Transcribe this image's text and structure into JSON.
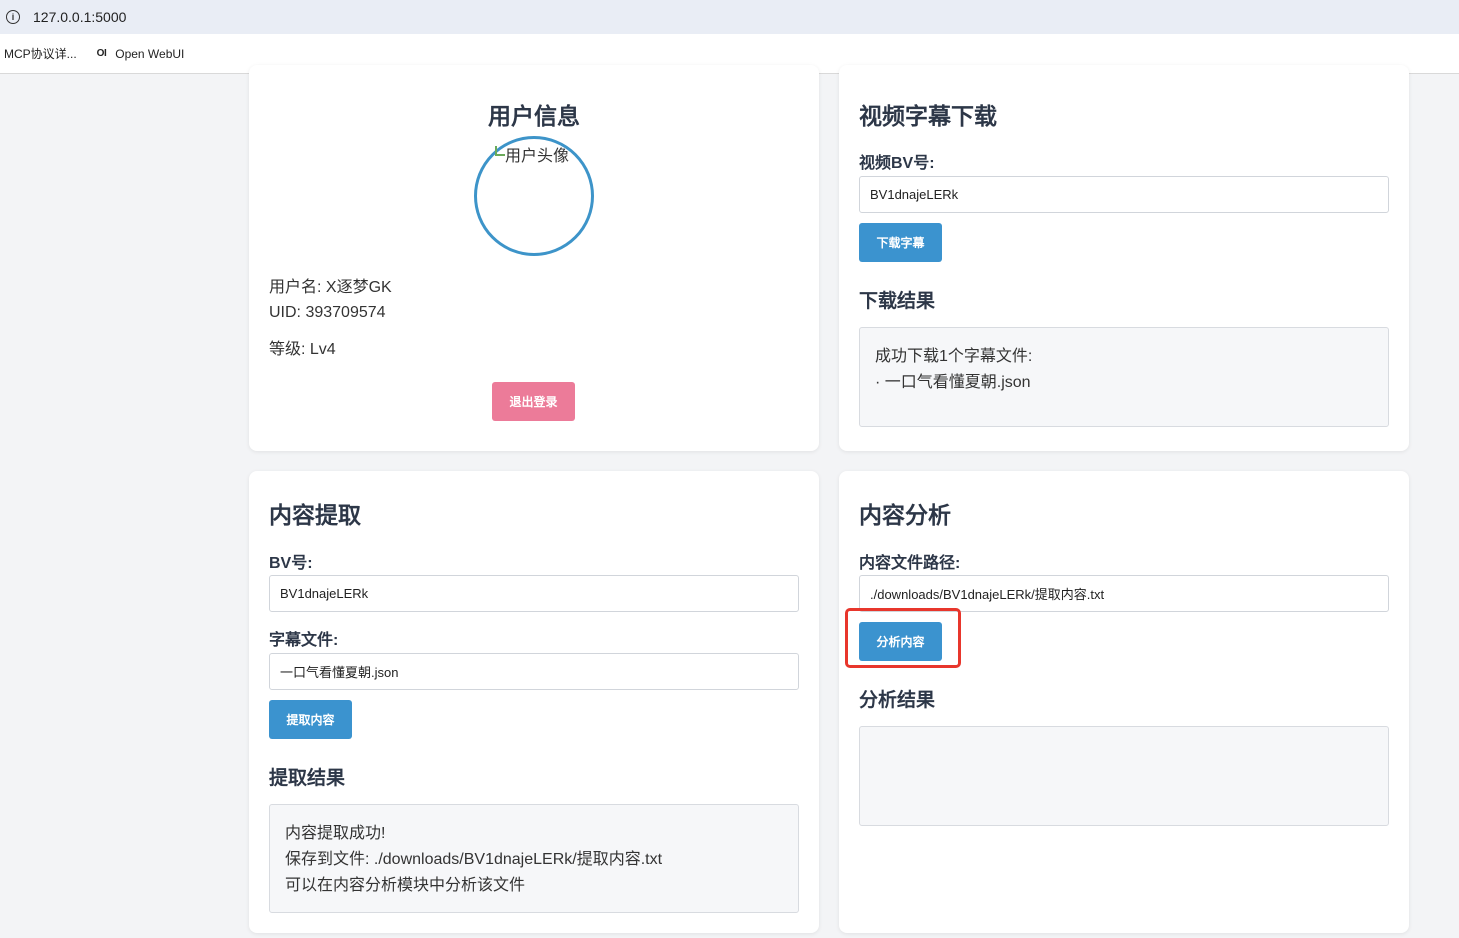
{
  "browser": {
    "url": "127.0.0.1:5000",
    "bookmarks": [
      {
        "label": "MCP协议详..."
      },
      {
        "icon_text": "OI",
        "label": "Open WebUI"
      }
    ]
  },
  "user_info": {
    "title": "用户信息",
    "avatar_alt": "用户头像",
    "username_line": "用户名: X逐梦GK",
    "uid_line": "UID: 393709574",
    "level_line": "等级: Lv4",
    "logout_label": "退出登录"
  },
  "subtitle_download": {
    "title": "视频字幕下载",
    "bv_label": "视频BV号:",
    "bv_value": "BV1dnajeLERk",
    "download_label": "下载字幕",
    "result_title": "下载结果",
    "result_lines": [
      "成功下载1个字幕文件:",
      "· 一口气看懂夏朝.json"
    ]
  },
  "content_extract": {
    "title": "内容提取",
    "bv_label": "BV号:",
    "bv_value": "BV1dnajeLERk",
    "subtitle_file_label": "字幕文件:",
    "subtitle_file_value": "一口气看懂夏朝.json",
    "extract_label": "提取内容",
    "result_title": "提取结果",
    "result_lines": [
      "内容提取成功!",
      "保存到文件: ./downloads/BV1dnajeLERk/提取内容.txt",
      "可以在内容分析模块中分析该文件"
    ]
  },
  "content_analysis": {
    "title": "内容分析",
    "path_label": "内容文件路径:",
    "path_value": "./downloads/BV1dnajeLERk/提取内容.txt",
    "analyze_label": "分析内容",
    "result_title": "分析结果",
    "result_text": ""
  },
  "colors": {
    "primary_button": "#3b93cf",
    "logout_button": "#ec7b99",
    "highlight_border": "#e8362c",
    "avatar_border": "#3d94c9"
  }
}
